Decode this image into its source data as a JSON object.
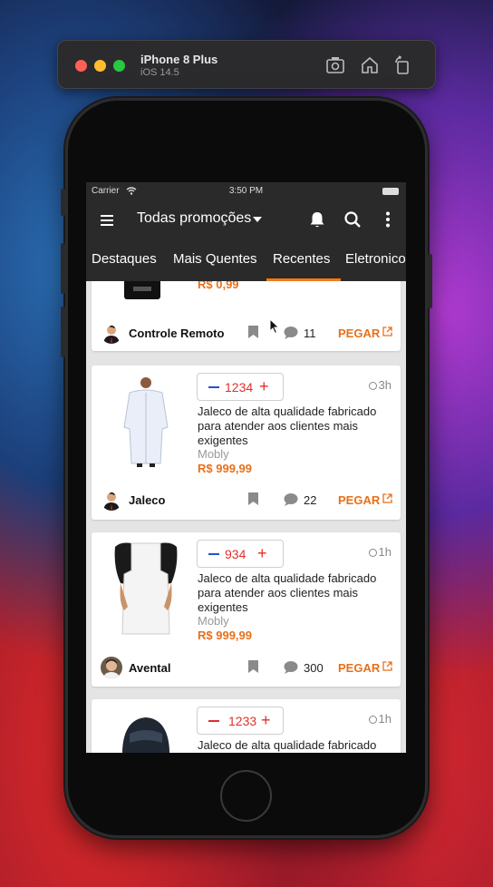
{
  "simulator": {
    "device": "iPhone 8 Plus",
    "os": "iOS 14.5",
    "icons": [
      "screenshot-icon",
      "home-icon",
      "rotate-icon"
    ]
  },
  "statusbar": {
    "carrier": "Carrier",
    "time": "3:50 PM"
  },
  "appbar": {
    "title": "Todas promoções",
    "icons": [
      "menu-icon",
      "bell-icon",
      "search-icon",
      "more-vert-icon"
    ]
  },
  "tabs": [
    {
      "label": "Destaques"
    },
    {
      "label": "Mais Quentes"
    },
    {
      "label": "Recentes",
      "active": true
    },
    {
      "label": "Eletronicos"
    }
  ],
  "colors": {
    "accent": "#f07a17",
    "price": "#e8701a",
    "temperature": "#e0302a",
    "appbar": "#2a2a2a"
  },
  "posts": [
    {
      "price_partial": "R$ 0,99",
      "user": "Controle Remoto",
      "comments": "11",
      "cta": "PEGAR"
    },
    {
      "temperature": "1234",
      "age": "3h",
      "description": "Jaleco de alta qualidade fabricado para atender aos clientes mais exigentes",
      "store": "Mobly",
      "price": "R$ 999,99",
      "user": "Jaleco",
      "comments": "22",
      "cta": "PEGAR"
    },
    {
      "temperature": "934",
      "age": "1h",
      "description": "Jaleco de alta qualidade fabricado para atender aos clientes mais exigentes",
      "store": "Mobly",
      "price": "R$ 999,99",
      "user": "Avental",
      "comments": "300",
      "cta": "PEGAR"
    },
    {
      "temperature": "1233",
      "age": "1h",
      "description": "Jaleco de alta qualidade fabricado"
    }
  ]
}
